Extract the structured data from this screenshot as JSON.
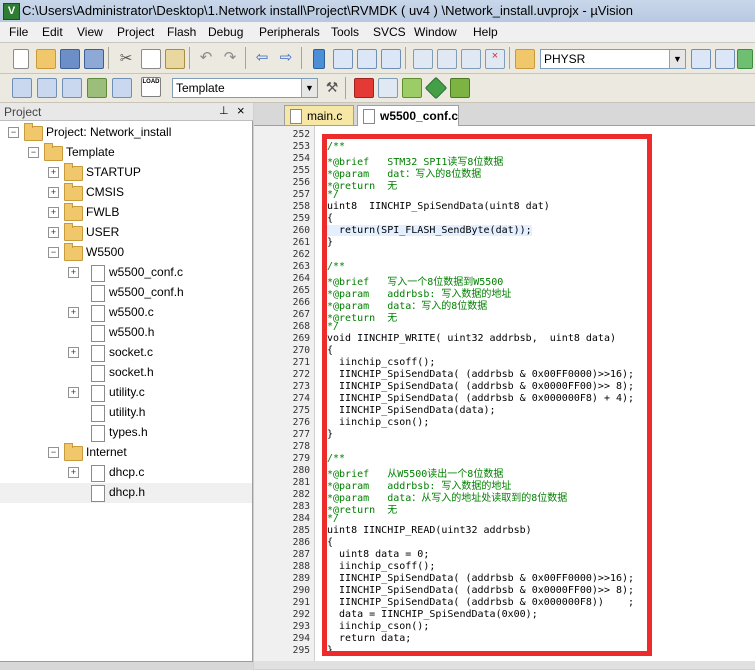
{
  "window": {
    "title": "C:\\Users\\Administrator\\Desktop\\1.Network install\\Project\\RVMDK ( uv4 ) \\Network_install.uvprojx - µVision",
    "app_icon": "uvision-icon"
  },
  "menu": [
    "File",
    "Edit",
    "View",
    "Project",
    "Flash",
    "Debug",
    "Peripherals",
    "Tools",
    "SVCS",
    "Window",
    "Help"
  ],
  "toolbar": {
    "find_combo_value": "PHYSR",
    "target_combo_value": "Template"
  },
  "project_panel": {
    "title": "Project",
    "pin_icon": "pin-icon",
    "close_glyph": "×",
    "tree": [
      {
        "label": "Project: Network_install",
        "level": 0,
        "type": "project",
        "expander": "−"
      },
      {
        "label": "Template",
        "level": 1,
        "type": "folder",
        "expander": "−"
      },
      {
        "label": "STARTUP",
        "level": 2,
        "type": "folder",
        "expander": "+"
      },
      {
        "label": "CMSIS",
        "level": 2,
        "type": "folder",
        "expander": "+"
      },
      {
        "label": "FWLB",
        "level": 2,
        "type": "folder",
        "expander": "+"
      },
      {
        "label": "USER",
        "level": 2,
        "type": "folder",
        "expander": "+"
      },
      {
        "label": "W5500",
        "level": 2,
        "type": "folder",
        "expander": "−"
      },
      {
        "label": "w5500_conf.c",
        "level": 3,
        "type": "file",
        "expander": "+"
      },
      {
        "label": "w5500_conf.h",
        "level": 3,
        "type": "file",
        "expander": ""
      },
      {
        "label": "w5500.c",
        "level": 3,
        "type": "file",
        "expander": "+"
      },
      {
        "label": "w5500.h",
        "level": 3,
        "type": "file",
        "expander": ""
      },
      {
        "label": "socket.c",
        "level": 3,
        "type": "file",
        "expander": "+"
      },
      {
        "label": "socket.h",
        "level": 3,
        "type": "file",
        "expander": ""
      },
      {
        "label": "utility.c",
        "level": 3,
        "type": "file",
        "expander": "+"
      },
      {
        "label": "utility.h",
        "level": 3,
        "type": "file",
        "expander": ""
      },
      {
        "label": "types.h",
        "level": 3,
        "type": "file",
        "expander": ""
      },
      {
        "label": "Internet",
        "level": 2,
        "type": "folder",
        "expander": "−"
      },
      {
        "label": "dhcp.c",
        "level": 3,
        "type": "file",
        "expander": "+"
      },
      {
        "label": "dhcp.h",
        "level": 3,
        "type": "file",
        "expander": "",
        "selected": true
      }
    ]
  },
  "editor": {
    "tabs": [
      {
        "label": "main.c",
        "active": false
      },
      {
        "label": "w5500_conf.c",
        "active": true
      }
    ],
    "lines": [
      {
        "n": "252",
        "text": "",
        "kind": "code"
      },
      {
        "n": "253",
        "text": "/**",
        "kind": "comment"
      },
      {
        "n": "254",
        "text": "*@brief   STM32 SPI1读写8位数据",
        "kind": "comment"
      },
      {
        "n": "255",
        "text": "*@param   dat：写入的8位数据",
        "kind": "comment"
      },
      {
        "n": "256",
        "text": "*@return  无",
        "kind": "comment"
      },
      {
        "n": "257",
        "text": "*/",
        "kind": "comment"
      },
      {
        "n": "258",
        "text": "uint8  IINCHIP_SpiSendData(uint8 dat)",
        "kind": "code"
      },
      {
        "n": "259",
        "text": "{",
        "kind": "code"
      },
      {
        "n": "260",
        "text": "  return(SPI_FLASH_SendByte(dat));",
        "kind": "code",
        "active": true
      },
      {
        "n": "261",
        "text": "}",
        "kind": "code"
      },
      {
        "n": "262",
        "text": "",
        "kind": "code"
      },
      {
        "n": "263",
        "text": "/**",
        "kind": "comment"
      },
      {
        "n": "264",
        "text": "*@brief   写入一个8位数据到W5500",
        "kind": "comment"
      },
      {
        "n": "265",
        "text": "*@param   addrbsb: 写入数据的地址",
        "kind": "comment"
      },
      {
        "n": "266",
        "text": "*@param   data：写入的8位数据",
        "kind": "comment"
      },
      {
        "n": "267",
        "text": "*@return  无",
        "kind": "comment"
      },
      {
        "n": "268",
        "text": "*/",
        "kind": "comment"
      },
      {
        "n": "269",
        "text": "void IINCHIP_WRITE( uint32 addrbsb,  uint8 data)",
        "kind": "code"
      },
      {
        "n": "270",
        "text": "{",
        "kind": "code"
      },
      {
        "n": "271",
        "text": "  iinchip_csoff();",
        "kind": "code"
      },
      {
        "n": "272",
        "text": "  IINCHIP_SpiSendData( (addrbsb & 0x00FF0000)>>16);",
        "kind": "code"
      },
      {
        "n": "273",
        "text": "  IINCHIP_SpiSendData( (addrbsb & 0x0000FF00)>> 8);",
        "kind": "code"
      },
      {
        "n": "274",
        "text": "  IINCHIP_SpiSendData( (addrbsb & 0x000000F8) + 4);",
        "kind": "code"
      },
      {
        "n": "275",
        "text": "  IINCHIP_SpiSendData(data);",
        "kind": "code"
      },
      {
        "n": "276",
        "text": "  iinchip_cson();",
        "kind": "code"
      },
      {
        "n": "277",
        "text": "}",
        "kind": "code"
      },
      {
        "n": "278",
        "text": "",
        "kind": "code"
      },
      {
        "n": "279",
        "text": "/**",
        "kind": "comment"
      },
      {
        "n": "280",
        "text": "*@brief   从W5500读出一个8位数据",
        "kind": "comment"
      },
      {
        "n": "281",
        "text": "*@param   addrbsb: 写入数据的地址",
        "kind": "comment"
      },
      {
        "n": "282",
        "text": "*@param   data：从写入的地址处读取到的8位数据",
        "kind": "comment"
      },
      {
        "n": "283",
        "text": "*@return  无",
        "kind": "comment"
      },
      {
        "n": "284",
        "text": "*/",
        "kind": "comment"
      },
      {
        "n": "285",
        "text": "uint8 IINCHIP_READ(uint32 addrbsb)",
        "kind": "code"
      },
      {
        "n": "286",
        "text": "{",
        "kind": "code"
      },
      {
        "n": "287",
        "text": "  uint8 data = 0;",
        "kind": "code"
      },
      {
        "n": "288",
        "text": "  iinchip_csoff();",
        "kind": "code"
      },
      {
        "n": "289",
        "text": "  IINCHIP_SpiSendData( (addrbsb & 0x00FF0000)>>16);",
        "kind": "code"
      },
      {
        "n": "290",
        "text": "  IINCHIP_SpiSendData( (addrbsb & 0x0000FF00)>> 8);",
        "kind": "code"
      },
      {
        "n": "291",
        "text": "  IINCHIP_SpiSendData( (addrbsb & 0x000000F8))    ;",
        "kind": "code"
      },
      {
        "n": "292",
        "text": "  data = IINCHIP_SpiSendData(0x00);",
        "kind": "code"
      },
      {
        "n": "293",
        "text": "  iinchip_cson();",
        "kind": "code"
      },
      {
        "n": "294",
        "text": "  return data;",
        "kind": "code"
      },
      {
        "n": "295",
        "text": "}",
        "kind": "code"
      }
    ]
  },
  "colors": {
    "highlight_box": "#ee2b2b",
    "comment": "#008000",
    "folder": "#f0c76a",
    "active_tab": "#ffffff",
    "inactive_tab": "#f6e7a5"
  }
}
